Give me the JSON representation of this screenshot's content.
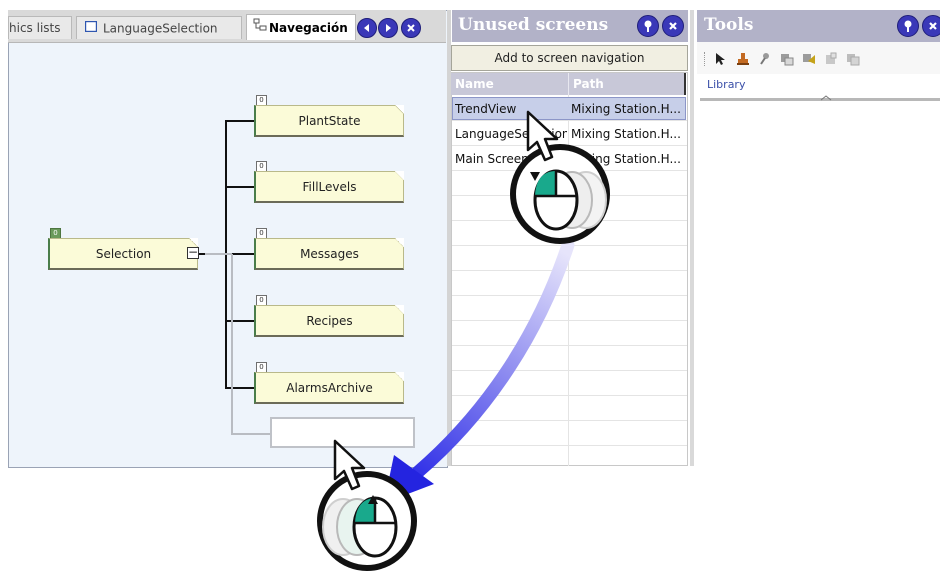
{
  "tabs": [
    {
      "label": "hics lists"
    },
    {
      "label": "LanguageSelection"
    },
    {
      "label": "Navegación"
    }
  ],
  "navigation": {
    "root": {
      "label": "Selection",
      "badge": "0"
    },
    "children": [
      {
        "label": "PlantState",
        "badge": "0"
      },
      {
        "label": "FillLevels",
        "badge": "0"
      },
      {
        "label": "Messages",
        "badge": "0"
      },
      {
        "label": "Recipes",
        "badge": "0"
      },
      {
        "label": "AlarmsArchive",
        "badge": "0"
      }
    ],
    "collapse_glyph": "−"
  },
  "unused_screens": {
    "title": "Unused screens",
    "add_button": "Add to screen navigation",
    "columns": [
      "Name",
      "Path"
    ],
    "rows": [
      {
        "name": "TrendView",
        "path": "Mixing Station.H...",
        "selected": true
      },
      {
        "name": "LanguageSelection",
        "path": "Mixing Station.H...",
        "selected": false
      },
      {
        "name": "Main Screen",
        "path": "Mixing Station.H...",
        "selected": false
      }
    ]
  },
  "tools": {
    "title": "Tools",
    "library_label": "Library",
    "toolbar_icons": [
      "pointer-icon",
      "stamp-icon",
      "pin-icon",
      "copy-icon",
      "paste-icon",
      "delete-icon",
      "duplicate-icon"
    ]
  },
  "colors": {
    "panel_header": "#b2b2c8",
    "drag_arrow": "#2a2adf",
    "selected_row": "#c7cfe9",
    "node_fill": "#fbfbd8"
  }
}
